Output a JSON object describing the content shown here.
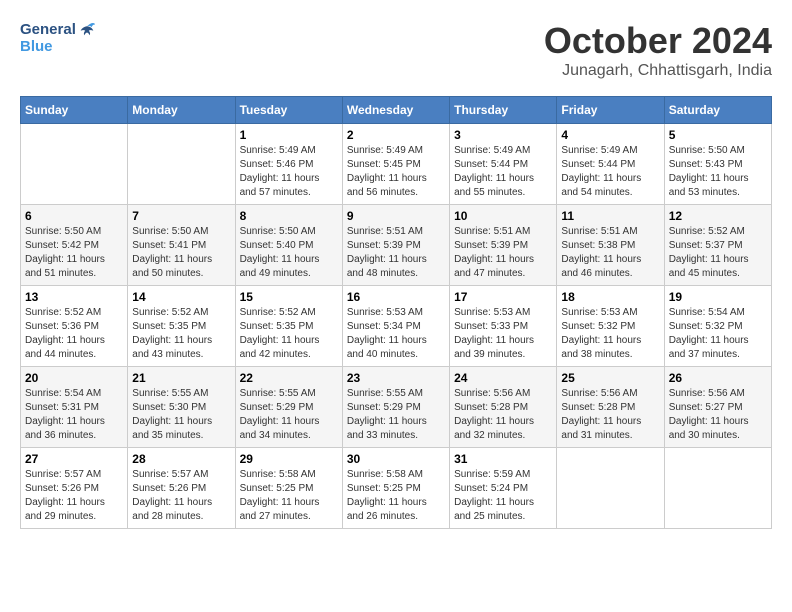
{
  "header": {
    "logo_general": "General",
    "logo_blue": "Blue",
    "month": "October 2024",
    "location": "Junagarh, Chhattisgarh, India"
  },
  "weekdays": [
    "Sunday",
    "Monday",
    "Tuesday",
    "Wednesday",
    "Thursday",
    "Friday",
    "Saturday"
  ],
  "weeks": [
    [
      {
        "day": "",
        "info": ""
      },
      {
        "day": "",
        "info": ""
      },
      {
        "day": "1",
        "info": "Sunrise: 5:49 AM\nSunset: 5:46 PM\nDaylight: 11 hours and 57 minutes."
      },
      {
        "day": "2",
        "info": "Sunrise: 5:49 AM\nSunset: 5:45 PM\nDaylight: 11 hours and 56 minutes."
      },
      {
        "day": "3",
        "info": "Sunrise: 5:49 AM\nSunset: 5:44 PM\nDaylight: 11 hours and 55 minutes."
      },
      {
        "day": "4",
        "info": "Sunrise: 5:49 AM\nSunset: 5:44 PM\nDaylight: 11 hours and 54 minutes."
      },
      {
        "day": "5",
        "info": "Sunrise: 5:50 AM\nSunset: 5:43 PM\nDaylight: 11 hours and 53 minutes."
      }
    ],
    [
      {
        "day": "6",
        "info": "Sunrise: 5:50 AM\nSunset: 5:42 PM\nDaylight: 11 hours and 51 minutes."
      },
      {
        "day": "7",
        "info": "Sunrise: 5:50 AM\nSunset: 5:41 PM\nDaylight: 11 hours and 50 minutes."
      },
      {
        "day": "8",
        "info": "Sunrise: 5:50 AM\nSunset: 5:40 PM\nDaylight: 11 hours and 49 minutes."
      },
      {
        "day": "9",
        "info": "Sunrise: 5:51 AM\nSunset: 5:39 PM\nDaylight: 11 hours and 48 minutes."
      },
      {
        "day": "10",
        "info": "Sunrise: 5:51 AM\nSunset: 5:39 PM\nDaylight: 11 hours and 47 minutes."
      },
      {
        "day": "11",
        "info": "Sunrise: 5:51 AM\nSunset: 5:38 PM\nDaylight: 11 hours and 46 minutes."
      },
      {
        "day": "12",
        "info": "Sunrise: 5:52 AM\nSunset: 5:37 PM\nDaylight: 11 hours and 45 minutes."
      }
    ],
    [
      {
        "day": "13",
        "info": "Sunrise: 5:52 AM\nSunset: 5:36 PM\nDaylight: 11 hours and 44 minutes."
      },
      {
        "day": "14",
        "info": "Sunrise: 5:52 AM\nSunset: 5:35 PM\nDaylight: 11 hours and 43 minutes."
      },
      {
        "day": "15",
        "info": "Sunrise: 5:52 AM\nSunset: 5:35 PM\nDaylight: 11 hours and 42 minutes."
      },
      {
        "day": "16",
        "info": "Sunrise: 5:53 AM\nSunset: 5:34 PM\nDaylight: 11 hours and 40 minutes."
      },
      {
        "day": "17",
        "info": "Sunrise: 5:53 AM\nSunset: 5:33 PM\nDaylight: 11 hours and 39 minutes."
      },
      {
        "day": "18",
        "info": "Sunrise: 5:53 AM\nSunset: 5:32 PM\nDaylight: 11 hours and 38 minutes."
      },
      {
        "day": "19",
        "info": "Sunrise: 5:54 AM\nSunset: 5:32 PM\nDaylight: 11 hours and 37 minutes."
      }
    ],
    [
      {
        "day": "20",
        "info": "Sunrise: 5:54 AM\nSunset: 5:31 PM\nDaylight: 11 hours and 36 minutes."
      },
      {
        "day": "21",
        "info": "Sunrise: 5:55 AM\nSunset: 5:30 PM\nDaylight: 11 hours and 35 minutes."
      },
      {
        "day": "22",
        "info": "Sunrise: 5:55 AM\nSunset: 5:29 PM\nDaylight: 11 hours and 34 minutes."
      },
      {
        "day": "23",
        "info": "Sunrise: 5:55 AM\nSunset: 5:29 PM\nDaylight: 11 hours and 33 minutes."
      },
      {
        "day": "24",
        "info": "Sunrise: 5:56 AM\nSunset: 5:28 PM\nDaylight: 11 hours and 32 minutes."
      },
      {
        "day": "25",
        "info": "Sunrise: 5:56 AM\nSunset: 5:28 PM\nDaylight: 11 hours and 31 minutes."
      },
      {
        "day": "26",
        "info": "Sunrise: 5:56 AM\nSunset: 5:27 PM\nDaylight: 11 hours and 30 minutes."
      }
    ],
    [
      {
        "day": "27",
        "info": "Sunrise: 5:57 AM\nSunset: 5:26 PM\nDaylight: 11 hours and 29 minutes."
      },
      {
        "day": "28",
        "info": "Sunrise: 5:57 AM\nSunset: 5:26 PM\nDaylight: 11 hours and 28 minutes."
      },
      {
        "day": "29",
        "info": "Sunrise: 5:58 AM\nSunset: 5:25 PM\nDaylight: 11 hours and 27 minutes."
      },
      {
        "day": "30",
        "info": "Sunrise: 5:58 AM\nSunset: 5:25 PM\nDaylight: 11 hours and 26 minutes."
      },
      {
        "day": "31",
        "info": "Sunrise: 5:59 AM\nSunset: 5:24 PM\nDaylight: 11 hours and 25 minutes."
      },
      {
        "day": "",
        "info": ""
      },
      {
        "day": "",
        "info": ""
      }
    ]
  ]
}
